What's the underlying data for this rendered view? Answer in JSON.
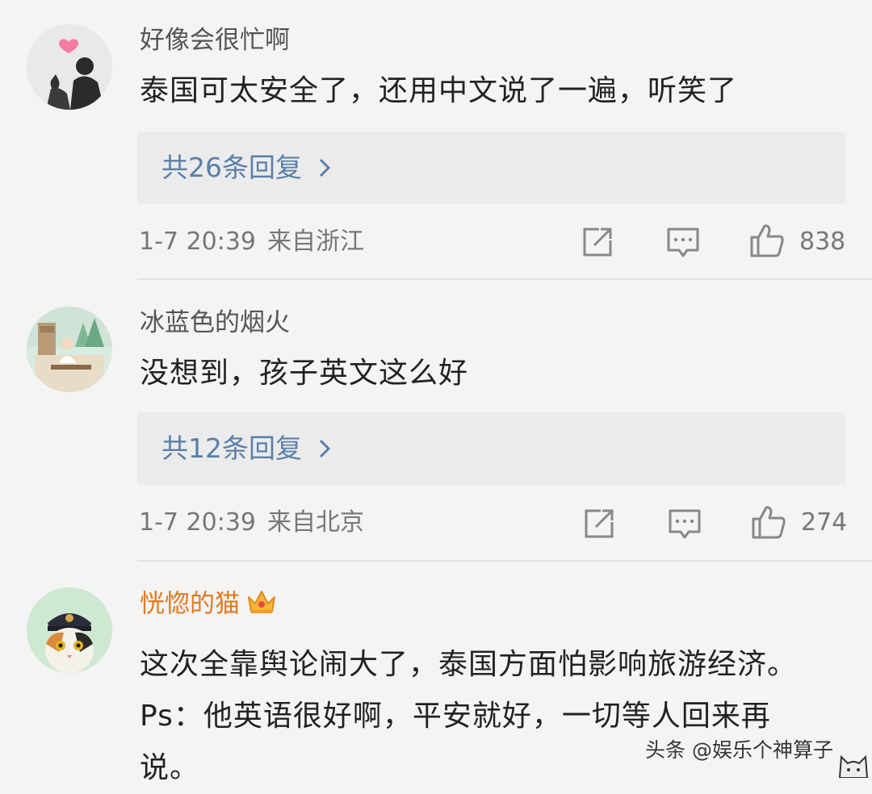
{
  "comments": [
    {
      "username": "好像会很忙啊",
      "text": "泰国可太安全了，还用中文说了一遍，听笑了",
      "replies": "共26条回复",
      "time": "1-7 20:39",
      "location": "来自浙江",
      "likes": "838"
    },
    {
      "username": "冰蓝色的烟火",
      "text": "没想到，孩子英文这么好",
      "replies": "共12条回复",
      "time": "1-7 20:39",
      "location": "来自北京",
      "likes": "274"
    },
    {
      "username": "恍惚的猫",
      "text": "这次全靠舆论闹大了，泰国方面怕影响旅游经济。Ps：他英语很好啊，平安就好，一切等人回来再说。"
    }
  ],
  "watermark": "头条 @娱乐个神算子",
  "colors": {
    "background": "#f4f4f4",
    "reply_link": "#5a7fa8",
    "vip_name": "#e07a1f",
    "meta_text": "#777777"
  },
  "icons": [
    "share-icon",
    "comment-icon",
    "like-icon",
    "chevron-right-icon",
    "crown-icon"
  ]
}
